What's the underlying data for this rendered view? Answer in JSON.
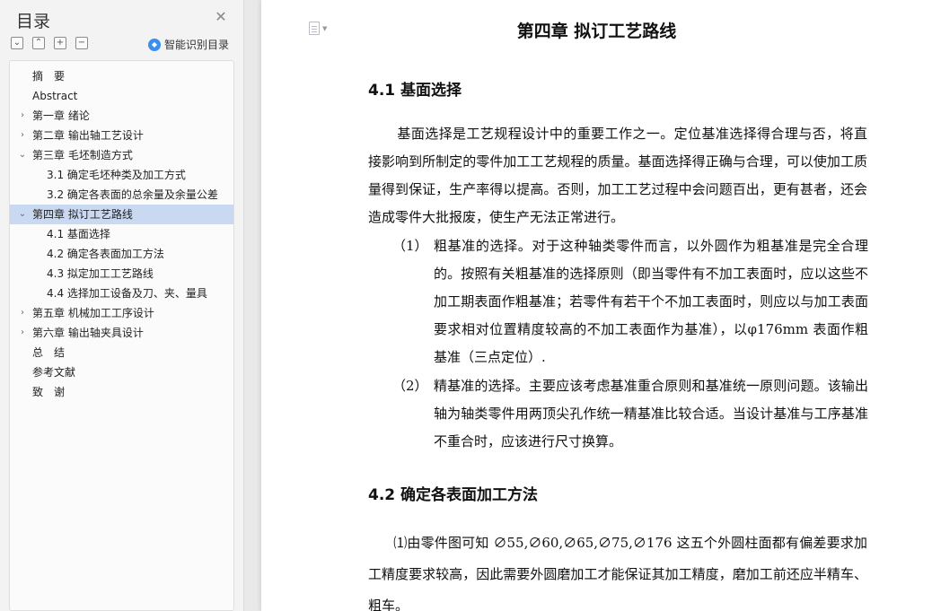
{
  "sidebar": {
    "title": "目录",
    "close_icon": "close-icon",
    "tools": [
      {
        "name": "collapse-all-icon",
        "glyph": "⌄"
      },
      {
        "name": "expand-all-icon",
        "glyph": "⌃"
      },
      {
        "name": "add-heading-icon",
        "glyph": "+"
      },
      {
        "name": "remove-heading-icon",
        "glyph": "−"
      }
    ],
    "smart_label": "智能识别目录",
    "toc": [
      {
        "label": "摘　要",
        "level": 0,
        "arrow": ""
      },
      {
        "label": "Abstract",
        "level": 0,
        "arrow": ""
      },
      {
        "label": "第一章  绪论",
        "level": 0,
        "arrow": "›"
      },
      {
        "label": "第二章  输出轴工艺设计",
        "level": 0,
        "arrow": "›"
      },
      {
        "label": "第三章  毛坯制造方式",
        "level": 0,
        "arrow": "⌄"
      },
      {
        "label": "3.1 确定毛坯种类及加工方式",
        "level": 1,
        "arrow": ""
      },
      {
        "label": "3.2 确定各表面的总余量及余量公差",
        "level": 1,
        "arrow": ""
      },
      {
        "label": "第四章  拟订工艺路线",
        "level": 0,
        "arrow": "⌄",
        "active": true
      },
      {
        "label": "4.1 基面选择",
        "level": 1,
        "arrow": ""
      },
      {
        "label": "4.2 确定各表面加工方法",
        "level": 1,
        "arrow": ""
      },
      {
        "label": "4.3 拟定加工工艺路线",
        "level": 1,
        "arrow": ""
      },
      {
        "label": "4.4 选择加工设备及刀、夹、量具",
        "level": 1,
        "arrow": ""
      },
      {
        "label": "第五章  机械加工工序设计",
        "level": 0,
        "arrow": "›"
      },
      {
        "label": "第六章  输出轴夹具设计",
        "level": 0,
        "arrow": "›"
      },
      {
        "label": "总　结",
        "level": 0,
        "arrow": ""
      },
      {
        "label": "参考文献",
        "level": 0,
        "arrow": ""
      },
      {
        "label": "致　谢",
        "level": 0,
        "arrow": ""
      }
    ]
  },
  "document": {
    "chapter_title": "第四章  拟订工艺路线",
    "section1_title": "4.1 基面选择",
    "section1_para": "基面选择是工艺规程设计中的重要工作之一。定位基准选择得合理与否，将直接影响到所制定的零件加工工艺规程的质量。基面选择得正确与合理，可以使加工质量得到保证，生产率得以提高。否则，加工工艺过程中会问题百出，更有甚者，还会造成零件大批报废，使生产无法正常进行。",
    "item1_num": "（1）",
    "item1_text": "粗基准的选择。对于这种轴类零件而言，以外圆作为粗基准是完全合理的。按照有关粗基准的选择原则（即当零件有不加工表面时，应以这些不加工期表面作粗基准；若零件有若干个不加工表面时，则应以与加工表面要求相对位置精度较高的不加工表面作为基准），以φ176mm 表面作粗基准（三点定位）.",
    "item2_num": "（2）",
    "item2_text": "精基准的选择。主要应该考虑基准重合原则和基准统一原则问题。该输出轴为轴类零件用两顶尖孔作统一精基准比较合适。当设计基准与工序基准不重合时，应该进行尺寸换算。",
    "section2_title": "4.2 确定各表面加工方法",
    "section2_para": "⑴由零件图可知 ∅55,∅60,∅65,∅75,∅176 这五个外圆柱面都有偏差要求加工精度要求较高，因此需要外圆磨加工才能保证其加工精度，磨加工前还应半精车、粗车。"
  }
}
